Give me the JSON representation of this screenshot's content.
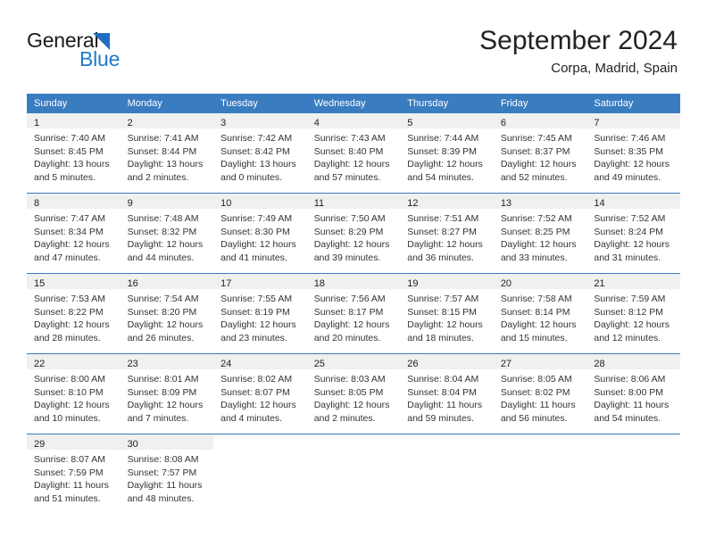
{
  "brand": {
    "name_top": "General",
    "name_bottom": "Blue",
    "accent_color": "#1f7ac8",
    "triangle_color": "#1f6fc0"
  },
  "header": {
    "title": "September 2024",
    "subtitle": "Corpa, Madrid, Spain"
  },
  "colors": {
    "header_row_bg": "#3a7cc0",
    "daynum_band_bg": "#f0f0f0",
    "week_divider": "#3a7cc0",
    "text": "#333333"
  },
  "weekday_headers": [
    "Sunday",
    "Monday",
    "Tuesday",
    "Wednesday",
    "Thursday",
    "Friday",
    "Saturday"
  ],
  "labels": {
    "sunrise_prefix": "Sunrise:",
    "sunset_prefix": "Sunset:",
    "daylight_prefix": "Daylight:"
  },
  "weeks": [
    [
      {
        "day": "1",
        "sunrise": "Sunrise: 7:40 AM",
        "sunset": "Sunset: 8:45 PM",
        "daylight_1": "Daylight: 13 hours",
        "daylight_2": "and 5 minutes."
      },
      {
        "day": "2",
        "sunrise": "Sunrise: 7:41 AM",
        "sunset": "Sunset: 8:44 PM",
        "daylight_1": "Daylight: 13 hours",
        "daylight_2": "and 2 minutes."
      },
      {
        "day": "3",
        "sunrise": "Sunrise: 7:42 AM",
        "sunset": "Sunset: 8:42 PM",
        "daylight_1": "Daylight: 13 hours",
        "daylight_2": "and 0 minutes."
      },
      {
        "day": "4",
        "sunrise": "Sunrise: 7:43 AM",
        "sunset": "Sunset: 8:40 PM",
        "daylight_1": "Daylight: 12 hours",
        "daylight_2": "and 57 minutes."
      },
      {
        "day": "5",
        "sunrise": "Sunrise: 7:44 AM",
        "sunset": "Sunset: 8:39 PM",
        "daylight_1": "Daylight: 12 hours",
        "daylight_2": "and 54 minutes."
      },
      {
        "day": "6",
        "sunrise": "Sunrise: 7:45 AM",
        "sunset": "Sunset: 8:37 PM",
        "daylight_1": "Daylight: 12 hours",
        "daylight_2": "and 52 minutes."
      },
      {
        "day": "7",
        "sunrise": "Sunrise: 7:46 AM",
        "sunset": "Sunset: 8:35 PM",
        "daylight_1": "Daylight: 12 hours",
        "daylight_2": "and 49 minutes."
      }
    ],
    [
      {
        "day": "8",
        "sunrise": "Sunrise: 7:47 AM",
        "sunset": "Sunset: 8:34 PM",
        "daylight_1": "Daylight: 12 hours",
        "daylight_2": "and 47 minutes."
      },
      {
        "day": "9",
        "sunrise": "Sunrise: 7:48 AM",
        "sunset": "Sunset: 8:32 PM",
        "daylight_1": "Daylight: 12 hours",
        "daylight_2": "and 44 minutes."
      },
      {
        "day": "10",
        "sunrise": "Sunrise: 7:49 AM",
        "sunset": "Sunset: 8:30 PM",
        "daylight_1": "Daylight: 12 hours",
        "daylight_2": "and 41 minutes."
      },
      {
        "day": "11",
        "sunrise": "Sunrise: 7:50 AM",
        "sunset": "Sunset: 8:29 PM",
        "daylight_1": "Daylight: 12 hours",
        "daylight_2": "and 39 minutes."
      },
      {
        "day": "12",
        "sunrise": "Sunrise: 7:51 AM",
        "sunset": "Sunset: 8:27 PM",
        "daylight_1": "Daylight: 12 hours",
        "daylight_2": "and 36 minutes."
      },
      {
        "day": "13",
        "sunrise": "Sunrise: 7:52 AM",
        "sunset": "Sunset: 8:25 PM",
        "daylight_1": "Daylight: 12 hours",
        "daylight_2": "and 33 minutes."
      },
      {
        "day": "14",
        "sunrise": "Sunrise: 7:52 AM",
        "sunset": "Sunset: 8:24 PM",
        "daylight_1": "Daylight: 12 hours",
        "daylight_2": "and 31 minutes."
      }
    ],
    [
      {
        "day": "15",
        "sunrise": "Sunrise: 7:53 AM",
        "sunset": "Sunset: 8:22 PM",
        "daylight_1": "Daylight: 12 hours",
        "daylight_2": "and 28 minutes."
      },
      {
        "day": "16",
        "sunrise": "Sunrise: 7:54 AM",
        "sunset": "Sunset: 8:20 PM",
        "daylight_1": "Daylight: 12 hours",
        "daylight_2": "and 26 minutes."
      },
      {
        "day": "17",
        "sunrise": "Sunrise: 7:55 AM",
        "sunset": "Sunset: 8:19 PM",
        "daylight_1": "Daylight: 12 hours",
        "daylight_2": "and 23 minutes."
      },
      {
        "day": "18",
        "sunrise": "Sunrise: 7:56 AM",
        "sunset": "Sunset: 8:17 PM",
        "daylight_1": "Daylight: 12 hours",
        "daylight_2": "and 20 minutes."
      },
      {
        "day": "19",
        "sunrise": "Sunrise: 7:57 AM",
        "sunset": "Sunset: 8:15 PM",
        "daylight_1": "Daylight: 12 hours",
        "daylight_2": "and 18 minutes."
      },
      {
        "day": "20",
        "sunrise": "Sunrise: 7:58 AM",
        "sunset": "Sunset: 8:14 PM",
        "daylight_1": "Daylight: 12 hours",
        "daylight_2": "and 15 minutes."
      },
      {
        "day": "21",
        "sunrise": "Sunrise: 7:59 AM",
        "sunset": "Sunset: 8:12 PM",
        "daylight_1": "Daylight: 12 hours",
        "daylight_2": "and 12 minutes."
      }
    ],
    [
      {
        "day": "22",
        "sunrise": "Sunrise: 8:00 AM",
        "sunset": "Sunset: 8:10 PM",
        "daylight_1": "Daylight: 12 hours",
        "daylight_2": "and 10 minutes."
      },
      {
        "day": "23",
        "sunrise": "Sunrise: 8:01 AM",
        "sunset": "Sunset: 8:09 PM",
        "daylight_1": "Daylight: 12 hours",
        "daylight_2": "and 7 minutes."
      },
      {
        "day": "24",
        "sunrise": "Sunrise: 8:02 AM",
        "sunset": "Sunset: 8:07 PM",
        "daylight_1": "Daylight: 12 hours",
        "daylight_2": "and 4 minutes."
      },
      {
        "day": "25",
        "sunrise": "Sunrise: 8:03 AM",
        "sunset": "Sunset: 8:05 PM",
        "daylight_1": "Daylight: 12 hours",
        "daylight_2": "and 2 minutes."
      },
      {
        "day": "26",
        "sunrise": "Sunrise: 8:04 AM",
        "sunset": "Sunset: 8:04 PM",
        "daylight_1": "Daylight: 11 hours",
        "daylight_2": "and 59 minutes."
      },
      {
        "day": "27",
        "sunrise": "Sunrise: 8:05 AM",
        "sunset": "Sunset: 8:02 PM",
        "daylight_1": "Daylight: 11 hours",
        "daylight_2": "and 56 minutes."
      },
      {
        "day": "28",
        "sunrise": "Sunrise: 8:06 AM",
        "sunset": "Sunset: 8:00 PM",
        "daylight_1": "Daylight: 11 hours",
        "daylight_2": "and 54 minutes."
      }
    ],
    [
      {
        "day": "29",
        "sunrise": "Sunrise: 8:07 AM",
        "sunset": "Sunset: 7:59 PM",
        "daylight_1": "Daylight: 11 hours",
        "daylight_2": "and 51 minutes."
      },
      {
        "day": "30",
        "sunrise": "Sunrise: 8:08 AM",
        "sunset": "Sunset: 7:57 PM",
        "daylight_1": "Daylight: 11 hours",
        "daylight_2": "and 48 minutes."
      },
      null,
      null,
      null,
      null,
      null
    ]
  ]
}
